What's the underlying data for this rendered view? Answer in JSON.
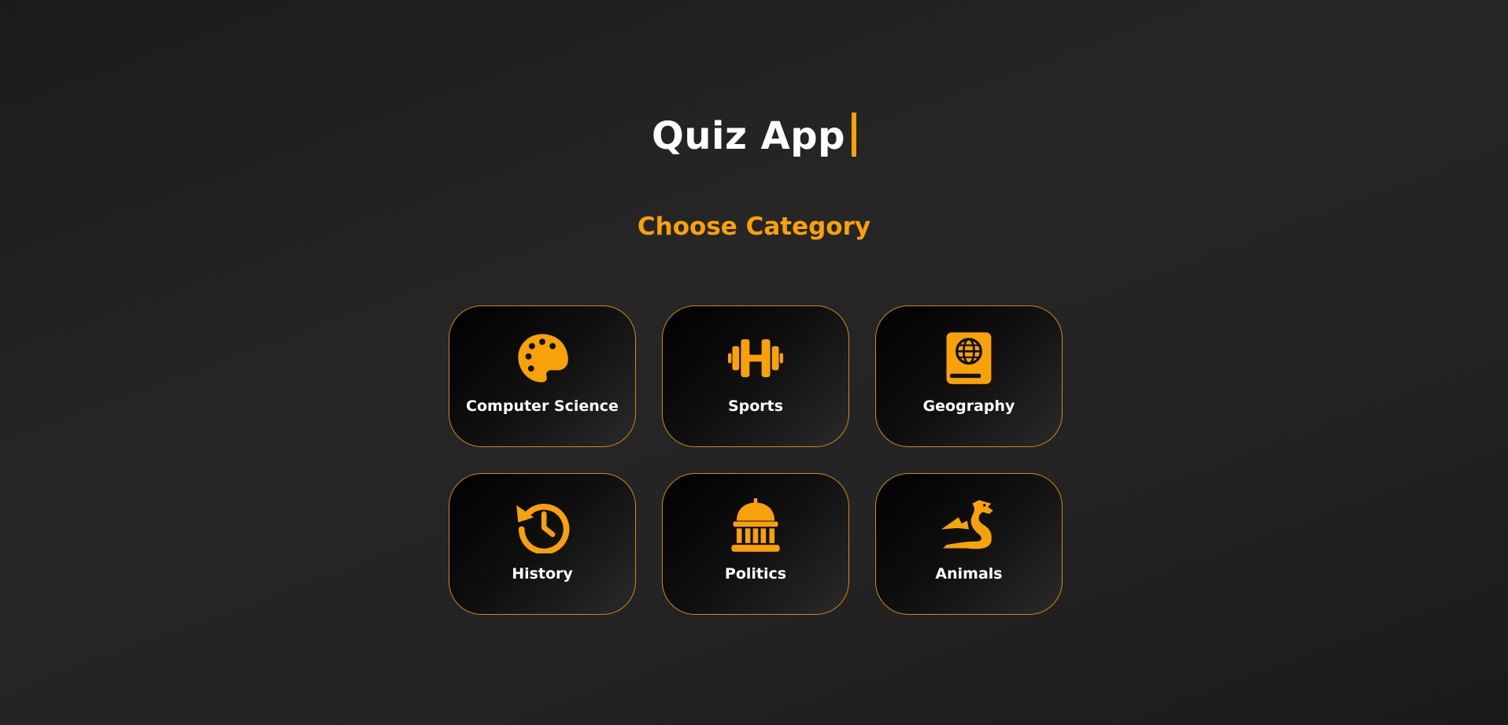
{
  "app": {
    "title": "Quiz App",
    "accent_color": "#f9a109"
  },
  "section": {
    "heading": "Choose Category"
  },
  "categories": [
    {
      "label": "Computer Science",
      "icon": "palette-icon"
    },
    {
      "label": "Sports",
      "icon": "dumbbell-icon"
    },
    {
      "label": "Geography",
      "icon": "globe-book-icon"
    },
    {
      "label": "History",
      "icon": "history-icon"
    },
    {
      "label": "Politics",
      "icon": "government-building-icon"
    },
    {
      "label": "Animals",
      "icon": "dragon-icon"
    }
  ]
}
